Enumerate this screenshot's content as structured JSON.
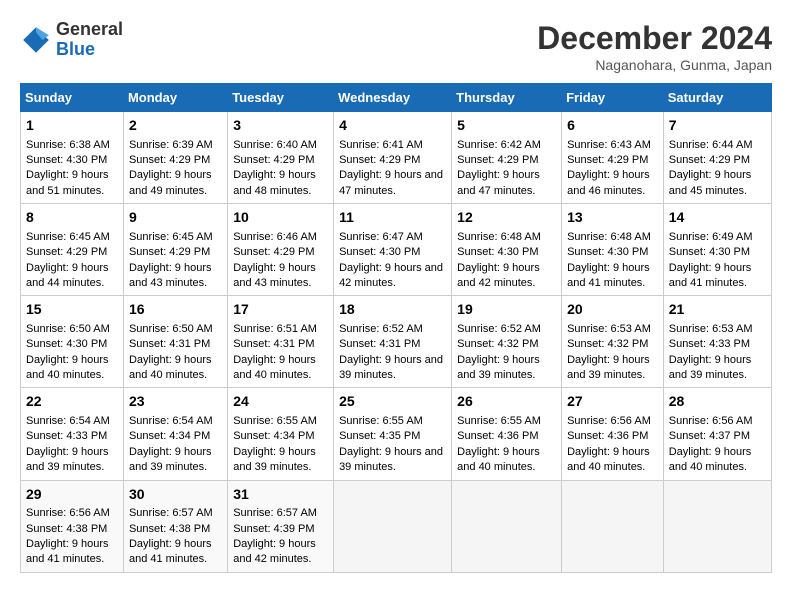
{
  "header": {
    "logo_general": "General",
    "logo_blue": "Blue",
    "month_title": "December 2024",
    "subtitle": "Naganohara, Gunma, Japan"
  },
  "weekdays": [
    "Sunday",
    "Monday",
    "Tuesday",
    "Wednesday",
    "Thursday",
    "Friday",
    "Saturday"
  ],
  "weeks": [
    [
      {
        "day": "1",
        "sunrise": "Sunrise: 6:38 AM",
        "sunset": "Sunset: 4:30 PM",
        "daylight": "Daylight: 9 hours and 51 minutes."
      },
      {
        "day": "2",
        "sunrise": "Sunrise: 6:39 AM",
        "sunset": "Sunset: 4:29 PM",
        "daylight": "Daylight: 9 hours and 49 minutes."
      },
      {
        "day": "3",
        "sunrise": "Sunrise: 6:40 AM",
        "sunset": "Sunset: 4:29 PM",
        "daylight": "Daylight: 9 hours and 48 minutes."
      },
      {
        "day": "4",
        "sunrise": "Sunrise: 6:41 AM",
        "sunset": "Sunset: 4:29 PM",
        "daylight": "Daylight: 9 hours and 47 minutes."
      },
      {
        "day": "5",
        "sunrise": "Sunrise: 6:42 AM",
        "sunset": "Sunset: 4:29 PM",
        "daylight": "Daylight: 9 hours and 47 minutes."
      },
      {
        "day": "6",
        "sunrise": "Sunrise: 6:43 AM",
        "sunset": "Sunset: 4:29 PM",
        "daylight": "Daylight: 9 hours and 46 minutes."
      },
      {
        "day": "7",
        "sunrise": "Sunrise: 6:44 AM",
        "sunset": "Sunset: 4:29 PM",
        "daylight": "Daylight: 9 hours and 45 minutes."
      }
    ],
    [
      {
        "day": "8",
        "sunrise": "Sunrise: 6:45 AM",
        "sunset": "Sunset: 4:29 PM",
        "daylight": "Daylight: 9 hours and 44 minutes."
      },
      {
        "day": "9",
        "sunrise": "Sunrise: 6:45 AM",
        "sunset": "Sunset: 4:29 PM",
        "daylight": "Daylight: 9 hours and 43 minutes."
      },
      {
        "day": "10",
        "sunrise": "Sunrise: 6:46 AM",
        "sunset": "Sunset: 4:29 PM",
        "daylight": "Daylight: 9 hours and 43 minutes."
      },
      {
        "day": "11",
        "sunrise": "Sunrise: 6:47 AM",
        "sunset": "Sunset: 4:30 PM",
        "daylight": "Daylight: 9 hours and 42 minutes."
      },
      {
        "day": "12",
        "sunrise": "Sunrise: 6:48 AM",
        "sunset": "Sunset: 4:30 PM",
        "daylight": "Daylight: 9 hours and 42 minutes."
      },
      {
        "day": "13",
        "sunrise": "Sunrise: 6:48 AM",
        "sunset": "Sunset: 4:30 PM",
        "daylight": "Daylight: 9 hours and 41 minutes."
      },
      {
        "day": "14",
        "sunrise": "Sunrise: 6:49 AM",
        "sunset": "Sunset: 4:30 PM",
        "daylight": "Daylight: 9 hours and 41 minutes."
      }
    ],
    [
      {
        "day": "15",
        "sunrise": "Sunrise: 6:50 AM",
        "sunset": "Sunset: 4:30 PM",
        "daylight": "Daylight: 9 hours and 40 minutes."
      },
      {
        "day": "16",
        "sunrise": "Sunrise: 6:50 AM",
        "sunset": "Sunset: 4:31 PM",
        "daylight": "Daylight: 9 hours and 40 minutes."
      },
      {
        "day": "17",
        "sunrise": "Sunrise: 6:51 AM",
        "sunset": "Sunset: 4:31 PM",
        "daylight": "Daylight: 9 hours and 40 minutes."
      },
      {
        "day": "18",
        "sunrise": "Sunrise: 6:52 AM",
        "sunset": "Sunset: 4:31 PM",
        "daylight": "Daylight: 9 hours and 39 minutes."
      },
      {
        "day": "19",
        "sunrise": "Sunrise: 6:52 AM",
        "sunset": "Sunset: 4:32 PM",
        "daylight": "Daylight: 9 hours and 39 minutes."
      },
      {
        "day": "20",
        "sunrise": "Sunrise: 6:53 AM",
        "sunset": "Sunset: 4:32 PM",
        "daylight": "Daylight: 9 hours and 39 minutes."
      },
      {
        "day": "21",
        "sunrise": "Sunrise: 6:53 AM",
        "sunset": "Sunset: 4:33 PM",
        "daylight": "Daylight: 9 hours and 39 minutes."
      }
    ],
    [
      {
        "day": "22",
        "sunrise": "Sunrise: 6:54 AM",
        "sunset": "Sunset: 4:33 PM",
        "daylight": "Daylight: 9 hours and 39 minutes."
      },
      {
        "day": "23",
        "sunrise": "Sunrise: 6:54 AM",
        "sunset": "Sunset: 4:34 PM",
        "daylight": "Daylight: 9 hours and 39 minutes."
      },
      {
        "day": "24",
        "sunrise": "Sunrise: 6:55 AM",
        "sunset": "Sunset: 4:34 PM",
        "daylight": "Daylight: 9 hours and 39 minutes."
      },
      {
        "day": "25",
        "sunrise": "Sunrise: 6:55 AM",
        "sunset": "Sunset: 4:35 PM",
        "daylight": "Daylight: 9 hours and 39 minutes."
      },
      {
        "day": "26",
        "sunrise": "Sunrise: 6:55 AM",
        "sunset": "Sunset: 4:36 PM",
        "daylight": "Daylight: 9 hours and 40 minutes."
      },
      {
        "day": "27",
        "sunrise": "Sunrise: 6:56 AM",
        "sunset": "Sunset: 4:36 PM",
        "daylight": "Daylight: 9 hours and 40 minutes."
      },
      {
        "day": "28",
        "sunrise": "Sunrise: 6:56 AM",
        "sunset": "Sunset: 4:37 PM",
        "daylight": "Daylight: 9 hours and 40 minutes."
      }
    ],
    [
      {
        "day": "29",
        "sunrise": "Sunrise: 6:56 AM",
        "sunset": "Sunset: 4:38 PM",
        "daylight": "Daylight: 9 hours and 41 minutes."
      },
      {
        "day": "30",
        "sunrise": "Sunrise: 6:57 AM",
        "sunset": "Sunset: 4:38 PM",
        "daylight": "Daylight: 9 hours and 41 minutes."
      },
      {
        "day": "31",
        "sunrise": "Sunrise: 6:57 AM",
        "sunset": "Sunset: 4:39 PM",
        "daylight": "Daylight: 9 hours and 42 minutes."
      },
      null,
      null,
      null,
      null
    ]
  ]
}
